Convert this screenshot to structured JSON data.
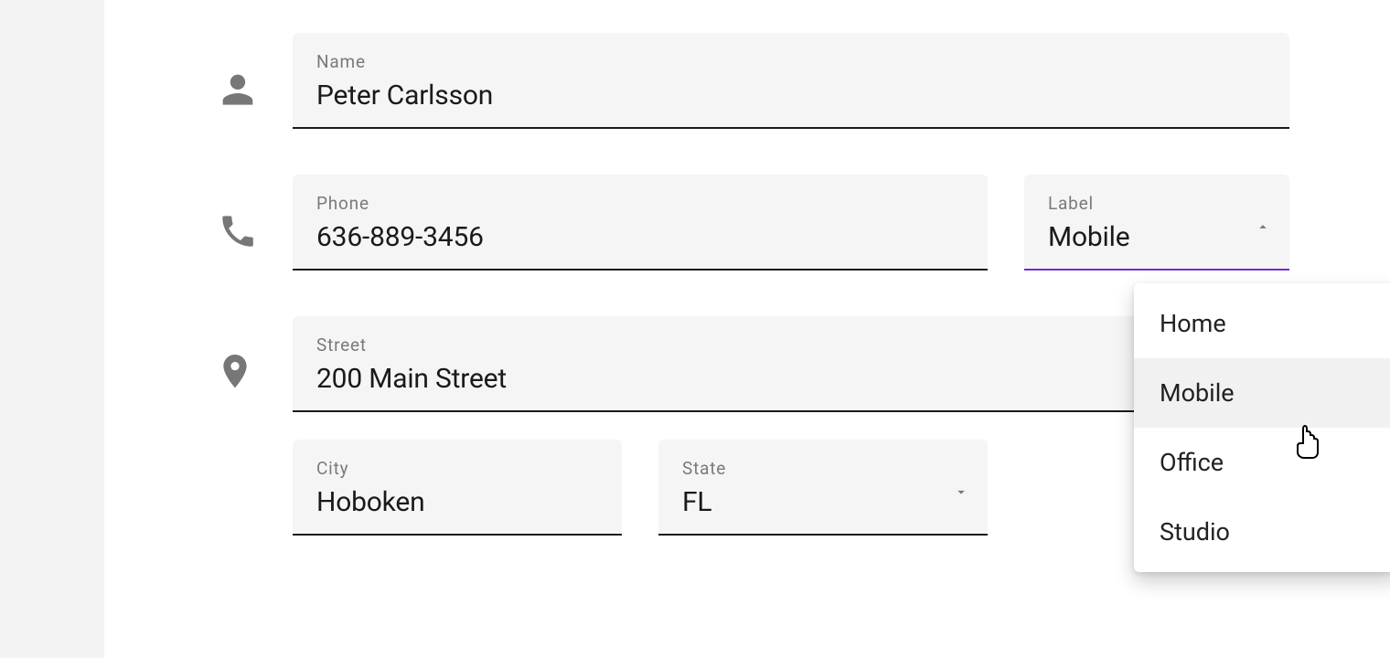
{
  "contact": {
    "name_label": "Name",
    "name_value": "Peter Carlsson",
    "phone_label": "Phone",
    "phone_value": "636-889-3456",
    "phone_type_label": "Label",
    "phone_type_value": "Mobile",
    "street_label": "Street",
    "street_value": "200 Main Street",
    "city_label": "City",
    "city_value": "Hoboken",
    "state_label": "State",
    "state_value": "FL"
  },
  "dropdown": {
    "options": [
      "Home",
      "Mobile",
      "Office",
      "Studio"
    ],
    "selected": "Mobile"
  },
  "colors": {
    "accent": "#6b2fd6",
    "field_bg": "#f5f5f5",
    "icon": "#777777"
  }
}
